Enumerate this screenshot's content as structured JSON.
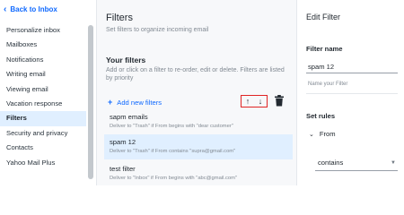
{
  "nav": {
    "back_label": "Back to Inbox",
    "items": [
      {
        "label": "Personalize inbox"
      },
      {
        "label": "Mailboxes"
      },
      {
        "label": "Notifications"
      },
      {
        "label": "Writing email"
      },
      {
        "label": "Viewing email"
      },
      {
        "label": "Vacation response"
      },
      {
        "label": "Filters"
      },
      {
        "label": "Security and privacy"
      },
      {
        "label": "Contacts"
      },
      {
        "label": "Yahoo Mail Plus"
      }
    ],
    "active_item": "Filters"
  },
  "filters": {
    "title": "Filters",
    "subtitle": "Set filters to organize incoming email",
    "section_title": "Your filters",
    "description": "Add or click on a filter to re-order, edit or delete. Filters are listed by priority",
    "add_label": "Add new filters",
    "move_up_icon": "arrow-up-icon",
    "move_down_icon": "arrow-down-icon",
    "delete_icon": "trash-icon",
    "list": [
      {
        "name": "sapm emails",
        "rule": "Deliver to \"Trash\" if From begins with \"dear customer\"",
        "selected": false
      },
      {
        "name": "spam 12",
        "rule": "Deliver to \"Trash\" if From contains \"supra@gmail.com\"",
        "selected": true
      },
      {
        "name": "test filter",
        "rule": "Deliver to \"Inbox\" if From begins with \"abc@gmail.com\"",
        "selected": false
      }
    ]
  },
  "edit": {
    "title": "Edit Filter",
    "name_label": "Filter name",
    "name_value": "spam 12",
    "name_hint": "Name your Filter",
    "rules_label": "Set rules",
    "from_label": "From",
    "condition_value": "contains"
  },
  "colors": {
    "accent": "#0f69ff",
    "highlight_border": "#e02424",
    "selected_bg": "#e0efff"
  }
}
